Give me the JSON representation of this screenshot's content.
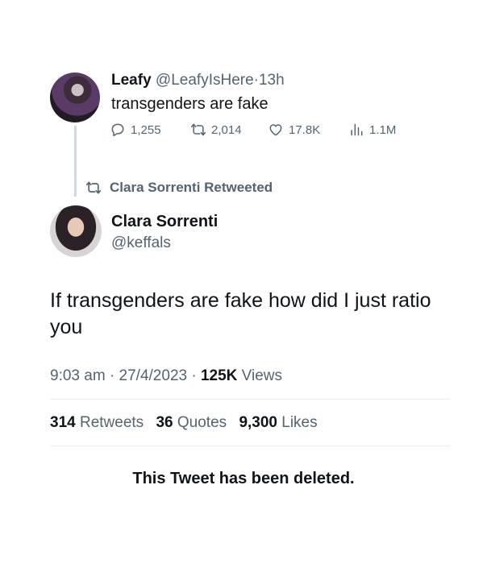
{
  "reply_tweet": {
    "name": "Leafy",
    "handle": "@LeafyIsHere",
    "separator": "·",
    "time": "13h",
    "text": "transgenders are fake",
    "replies": "1,255",
    "retweets": "2,014",
    "likes": "17.8K",
    "views": "1.1M"
  },
  "retweet_banner": {
    "text": "Clara Sorrenti Retweeted"
  },
  "main_tweet": {
    "name": "Clara Sorrenti",
    "handle": "@keffals",
    "text": "If transgenders are fake how did I just ratio you",
    "time": "9:03 am",
    "date": "27/4/2023",
    "separator": "·",
    "views_count": "125K",
    "views_label": "Views",
    "retweets_count": "314",
    "retweets_label": "Retweets",
    "quotes_count": "36",
    "quotes_label": "Quotes",
    "likes_count": "9,300",
    "likes_label": "Likes"
  },
  "deleted_notice": "This Tweet has been deleted.",
  "icons": [
    "reply-icon",
    "retweet-icon",
    "like-icon",
    "views-icon"
  ],
  "colors": {
    "muted": "#536471",
    "text": "#0f1419",
    "divider": "#e6ecf0"
  }
}
